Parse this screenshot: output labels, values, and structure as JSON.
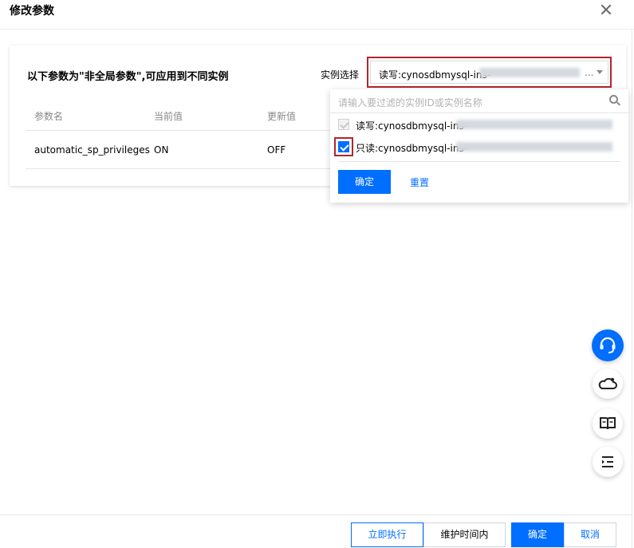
{
  "dialog": {
    "title": "修改参数"
  },
  "card": {
    "heading": "以下参数为\"非全局参数\",可应用到不同实例",
    "instance_label": "实例选择",
    "select": {
      "value_visible": "读写:cynosdbmysql-ins-",
      "ellipsis": "..."
    }
  },
  "table": {
    "headers": [
      "参数名",
      "当前值",
      "更新值"
    ],
    "rows": [
      {
        "name": "automatic_sp_privileges",
        "current": "ON",
        "new": "OFF"
      }
    ]
  },
  "dropdown": {
    "search_placeholder": "请输入要过滤的实例ID或实例名称",
    "options": [
      {
        "label": "读写:cynosdbmysql-ins-",
        "checked": true,
        "disabled": true
      },
      {
        "label": "只读:cynosdbmysql-ins-",
        "checked": true,
        "disabled": false
      }
    ],
    "confirm_label": "确定",
    "reset_label": "重置"
  },
  "float_buttons": [
    "headset-icon",
    "cloud-user-icon",
    "book-icon",
    "list-indent-icon"
  ],
  "footer": {
    "execute_now": "立即执行",
    "maintenance_window": "维护时间内",
    "confirm": "确定",
    "cancel": "取消"
  },
  "colors": {
    "accent": "#006eff",
    "highlight": "#b0262d"
  }
}
